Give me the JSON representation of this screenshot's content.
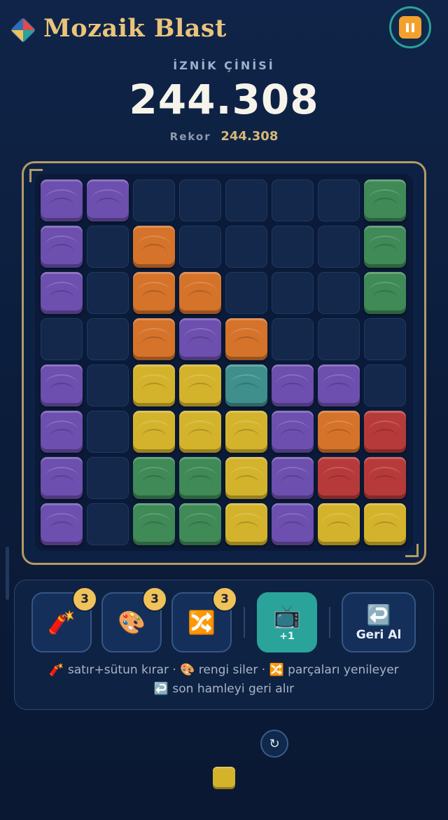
{
  "header": {
    "title": "Mozaik Blast",
    "pause_icon": "pause-icon"
  },
  "level": {
    "name": "İZNİK ÇİNİSİ"
  },
  "score": {
    "value": "244.308",
    "best_label": "Rekor",
    "best_value": "244.308"
  },
  "colors": {
    "P": "#6c4fae",
    "O": "#d5732a",
    "G": "#3f8a56",
    "Y": "#d4b32c",
    "T": "#3f8f8c",
    "R": "#b73a3a"
  },
  "board": {
    "rows": [
      [
        "P",
        "P",
        "",
        "",
        "",
        "",
        "",
        "G"
      ],
      [
        "P",
        "",
        "O",
        "",
        "",
        "",
        "",
        "G"
      ],
      [
        "P",
        "",
        "O",
        "O",
        "",
        "",
        "",
        "G"
      ],
      [
        "",
        "",
        "O",
        "P",
        "O",
        "",
        "",
        ""
      ],
      [
        "P",
        "",
        "Y",
        "Y",
        "T",
        "P",
        "P",
        ""
      ],
      [
        "P",
        "",
        "Y",
        "Y",
        "Y",
        "P",
        "O",
        "R"
      ],
      [
        "P",
        "",
        "G",
        "G",
        "Y",
        "P",
        "R",
        "R"
      ],
      [
        "P",
        "",
        "G",
        "G",
        "Y",
        "P",
        "Y",
        "Y"
      ]
    ]
  },
  "tools": [
    {
      "name": "dynamite",
      "icon": "🧨",
      "count": "3"
    },
    {
      "name": "palette",
      "icon": "🎨",
      "count": "3"
    },
    {
      "name": "shuffle",
      "icon": "🔀",
      "count": "3"
    }
  ],
  "ad_button": {
    "icon": "📺",
    "label": "+1"
  },
  "undo_button": {
    "icon": "↩️",
    "label": "Geri Al"
  },
  "hints": {
    "line1": "🧨 satır+sütun kırar · 🎨 rengi siler · 🔀 parçaları yenileyer",
    "line2": "↩️ son hamleyi geri alır"
  },
  "next": {
    "refresh_icon": "↻",
    "piece_color": "Y"
  }
}
